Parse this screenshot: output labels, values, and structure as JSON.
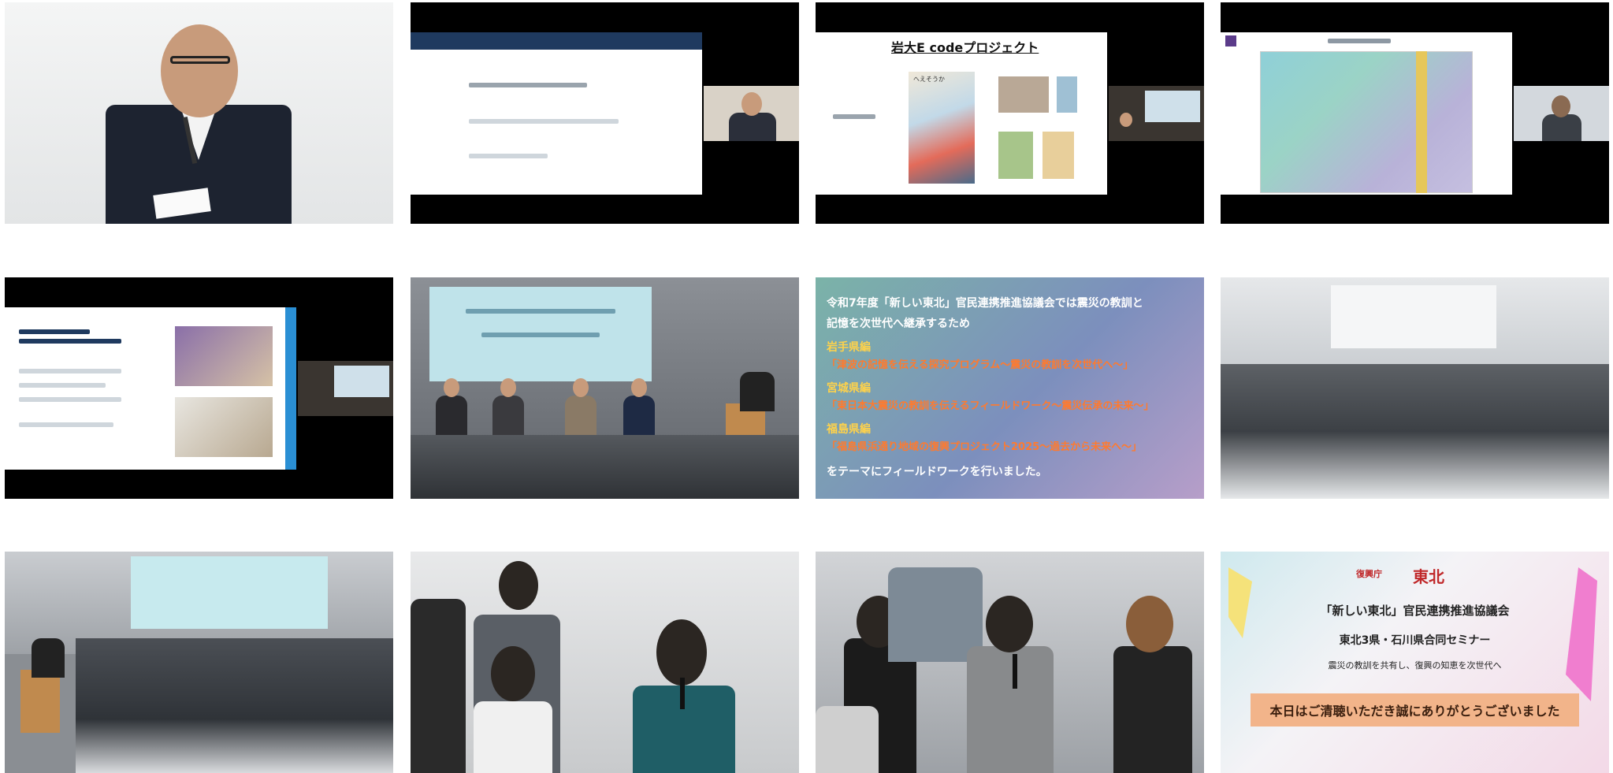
{
  "tiles": {
    "t3": {
      "title": "岩大E codeプロジェクト",
      "book_label": "へえそうか"
    },
    "t7": {
      "line1": "令和7年度「新しい東北」官民連携推進協議会では震災の教訓と",
      "line2": "記憶を次世代へ継承するため",
      "line3": "岩手県編",
      "line4": "「津波の記憶を伝える探究プログラム～震災の教訓を次世代へ～」",
      "line5": "宮城県編",
      "line6": "「東日本大震災の教訓を伝えるフィールドワーク～震災伝承の未来～」",
      "line7": "福島県編",
      "line8": "「福島県浜通り地域の復興プロジェクト2025～過去から未来へ～」",
      "line9": "をテーマにフィールドワークを行いました。"
    },
    "t12": {
      "logo_left": "復興庁",
      "logo_right": "東北",
      "title": "「新しい東北」官民連携推進協議会",
      "subtitle": "東北3県・石川県合同セミナー",
      "tagline": "震災の教訓を共有し、復興の知恵を次世代へ",
      "banner": "本日はご清聴いただき誠にありがとうございました"
    }
  },
  "colors": {
    "slide_header_navy": "#1f3a5f",
    "accent_blue": "#2a8fd4",
    "banner_orange": "#f2b48a",
    "fw_yellow": "#ffd24a",
    "fw_orange": "#ff7a2e"
  }
}
